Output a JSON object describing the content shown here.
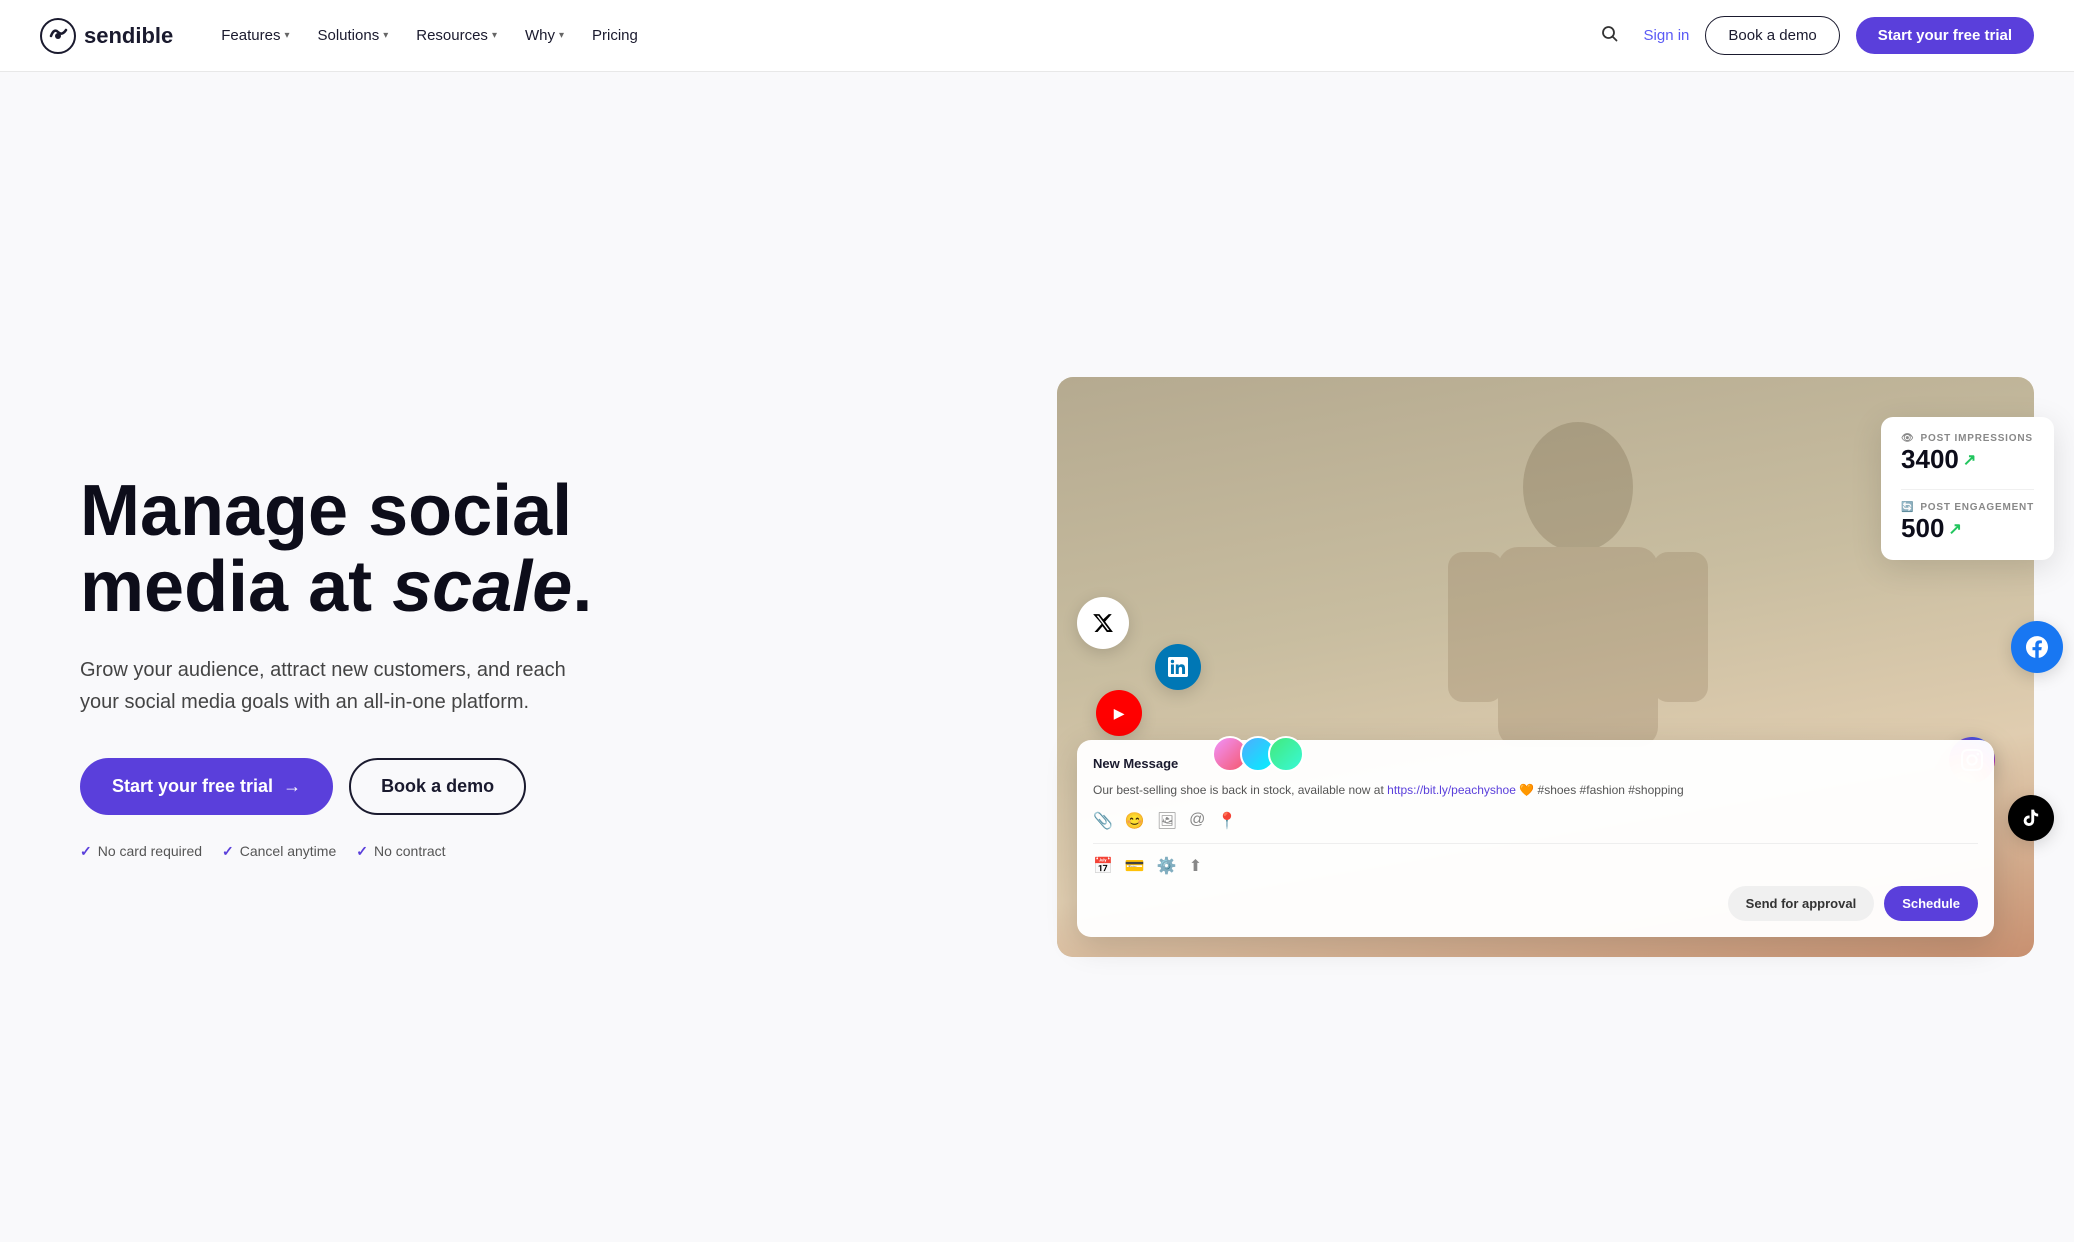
{
  "brand": {
    "name": "sendible",
    "logo_symbol": "◎"
  },
  "nav": {
    "links": [
      {
        "label": "Features",
        "has_chevron": true
      },
      {
        "label": "Solutions",
        "has_chevron": true
      },
      {
        "label": "Resources",
        "has_chevron": true
      },
      {
        "label": "Why",
        "has_chevron": true
      },
      {
        "label": "Pricing",
        "has_chevron": false
      }
    ],
    "sign_in": "Sign in",
    "book_demo": "Book a demo",
    "start_trial": "Start your free trial"
  },
  "hero": {
    "title_line1": "Manage social",
    "title_line2": "media at ",
    "title_italic": "scale",
    "title_period": ".",
    "subtitle": "Grow your audience, attract new customers, and reach your social media goals with an all-in-one platform.",
    "cta_primary": "Start your free trial",
    "cta_arrow": "→",
    "cta_secondary": "Book a demo",
    "trust": [
      {
        "label": "No card required"
      },
      {
        "label": "Cancel anytime"
      },
      {
        "label": "No contract"
      }
    ]
  },
  "stats_card": {
    "post_impressions_label": "POST IMPRESSIONS",
    "post_impressions_value": "3400",
    "post_engagement_label": "POST ENGAGEMENT",
    "post_engagement_value": "500"
  },
  "message_card": {
    "header": "New Message",
    "body": "Our best-selling shoe is back in stock, available now at",
    "link": "https://bit.ly/peachyshoe",
    "hashtags": " 🧡 #shoes #fashion #shopping",
    "send_approval": "Send for approval",
    "schedule": "Schedule"
  },
  "colors": {
    "brand_purple": "#5a3fdb",
    "text_dark": "#0d0d1a",
    "bg_light": "#f9f9fb"
  }
}
